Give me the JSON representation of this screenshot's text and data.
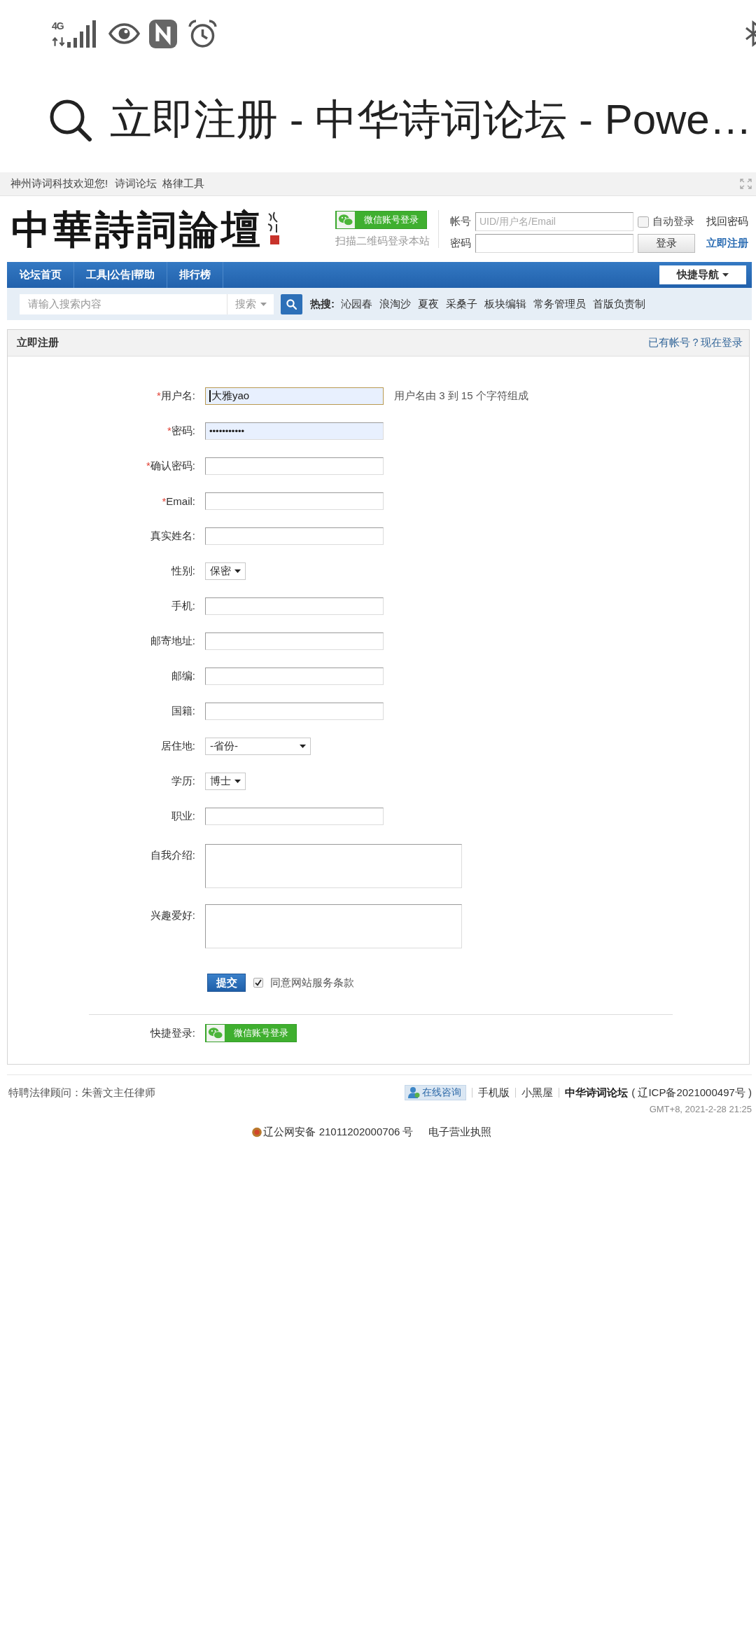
{
  "status_bar": {
    "network": "4G"
  },
  "browser_bar": {
    "title": "立即注册 - 中华诗词论坛 - Powe…"
  },
  "top_bar": {
    "welcome": "神州诗词科技欢迎您!",
    "links": [
      "诗词论坛",
      "格律工具"
    ]
  },
  "header": {
    "logo": "中華詩詞論壇",
    "wechat_login": "微信账号登录",
    "qr_hint": "扫描二维码登录本站",
    "account_label": "帐号",
    "account_placeholder": "UID/用户名/Email",
    "password_label": "密码",
    "auto_login": {
      "label": "自动登录",
      "checked": false
    },
    "forgot_password": "找回密码",
    "login_button": "登录",
    "register_link": "立即注册"
  },
  "nav": {
    "items": [
      "论坛首页",
      "工具|公告|帮助",
      "排行榜"
    ],
    "quick_nav": "快捷导航"
  },
  "search": {
    "placeholder": "请输入搜索内容",
    "scope": "搜索",
    "hot_label": "热搜:",
    "hot_items": [
      "沁园春",
      "浪淘沙",
      "夏夜",
      "采桑子",
      "板块编辑",
      "常务管理员",
      "首版负责制"
    ]
  },
  "register": {
    "title": "立即注册",
    "login_link": "已有帐号？现在登录",
    "fields": [
      {
        "kind": "text",
        "required_mark": "*",
        "label": "用户名:",
        "value": "大雅yao",
        "hint": "用户名由 3 到 15 个字符组成",
        "autofilled": true,
        "focused": true
      },
      {
        "kind": "password",
        "required_mark": "*",
        "label": "密码:",
        "value": "•••••••••••",
        "autofilled": true,
        "focused": false
      },
      {
        "kind": "password",
        "required_mark": "*",
        "label": "确认密码:",
        "autofilled": false,
        "focused": false
      },
      {
        "kind": "text",
        "required_mark": "*",
        "label": "Email:",
        "autofilled": false,
        "focused": false
      },
      {
        "kind": "text",
        "label": "真实姓名:",
        "autofilled": false,
        "focused": false
      },
      {
        "kind": "select",
        "label": "性别:",
        "value": "保密",
        "autofilled": false,
        "focused": false
      },
      {
        "kind": "text",
        "label": "手机:",
        "autofilled": false,
        "focused": false
      },
      {
        "kind": "text",
        "label": "邮寄地址:",
        "autofilled": false,
        "focused": false
      },
      {
        "kind": "text",
        "label": "邮编:",
        "autofilled": false,
        "focused": false
      },
      {
        "kind": "text",
        "label": "国籍:",
        "autofilled": false,
        "focused": false
      },
      {
        "kind": "region_select",
        "label": "居住地:",
        "value": "-省份-",
        "autofilled": false,
        "focused": false
      },
      {
        "kind": "select",
        "label": "学历:",
        "value": "博士",
        "autofilled": false,
        "focused": false
      },
      {
        "kind": "text",
        "label": "职业:",
        "autofilled": false,
        "focused": false
      },
      {
        "kind": "textarea",
        "label": "自我介绍:",
        "autofilled": false,
        "focused": false
      },
      {
        "kind": "textarea",
        "label": "兴趣爱好:",
        "autofilled": false,
        "focused": false
      }
    ],
    "submit_button": "提交",
    "agree": {
      "label": "同意网站服务条款",
      "checked": true
    },
    "quick_login": {
      "label": "快捷登录:",
      "button": "微信账号登录"
    }
  },
  "footer": {
    "legal_counsel": "特聘法律顾问：朱善文主任律师",
    "consult_button": "在线咨询",
    "links": [
      "手机版",
      "小黑屋"
    ],
    "site_name": "中华诗词论坛",
    "icp": "( 辽ICP备2021000497号 )",
    "timestamp": "GMT+8, 2021-2-28 21:25",
    "police_record": "辽公网安备 21011202000706 号",
    "license_link": "电子营业执照"
  }
}
